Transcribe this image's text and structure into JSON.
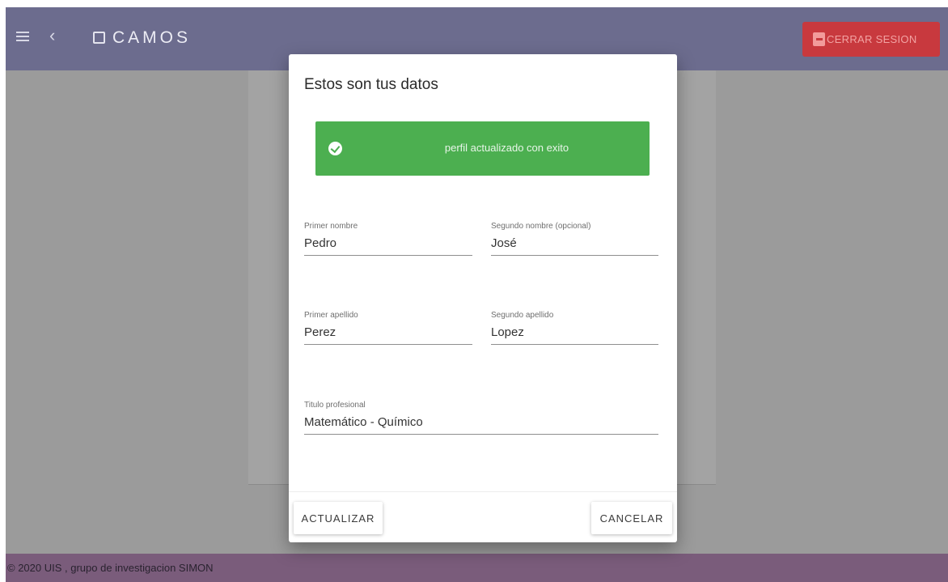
{
  "header": {
    "brand": "CAMOS",
    "logout_label": "CERRAR SESION",
    "icons": [
      "menu-icon",
      "chevron-left-icon",
      "square-logo-icon",
      "exit-icon"
    ],
    "colors": {
      "appbar": "#6c6c8e",
      "logout": "#c8393e"
    }
  },
  "dialog": {
    "title": "Estos son tus datos",
    "alert": {
      "message": "perfil actualizado con exito",
      "icon": "check-circle-icon",
      "color": "#4caf50"
    },
    "fields": {
      "first_name": {
        "label": "Primer nombre",
        "value": "Pedro"
      },
      "second_name": {
        "label": "Segundo nombre (opcional)",
        "value": "José"
      },
      "first_surname": {
        "label": "Primer apellido",
        "value": "Perez"
      },
      "second_surname": {
        "label": "Segundo apellido",
        "value": "Lopez"
      },
      "title": {
        "label": "Titulo profesional",
        "value": "Matemático - Químico"
      }
    },
    "actions": {
      "update_label": "ACTUALIZAR",
      "cancel_label": "CANCELAR"
    }
  },
  "footer": {
    "text": "© 2020 UIS , grupo de investigacion SIMON"
  }
}
